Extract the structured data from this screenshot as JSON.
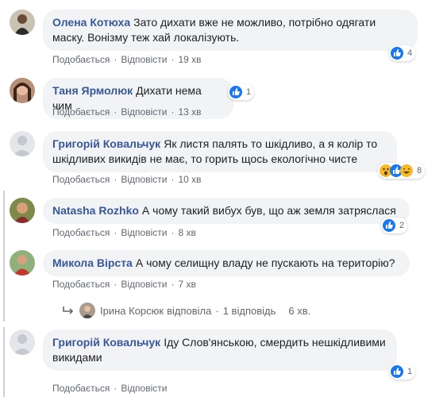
{
  "colors": {
    "bubble": "#f2f3f5",
    "author": "#385898",
    "meta": "#606770",
    "like": "#1877f2",
    "wow": "#f7b928",
    "thread_line": "#ccd0d5"
  },
  "comments": [
    {
      "author": "Олена Котюха",
      "text": "Зато дихати вже не можливо, потрібно одягати маску. Вонізму теж хай локалізують.",
      "like_label": "Подобається",
      "reply_label": "Відповісти",
      "time": "19 хв",
      "reactions": [
        "like-icon"
      ],
      "reaction_count": "4"
    },
    {
      "author": "Таня Ярмолюк",
      "text": "Дихати нема чим",
      "like_label": "Подобається",
      "reply_label": "Відповісти",
      "time": "13 хв",
      "reactions": [
        "like-icon"
      ],
      "reaction_count": "1"
    },
    {
      "author": "Григорій Ковальчук",
      "text": "Як листя палять то шкідливо, а я колір то шкідливих викидів не має, то горить щось екологічно чисте",
      "like_label": "Подобається",
      "reply_label": "Відповісти",
      "time": "10 хв",
      "reactions": [
        "wow-icon",
        "like-icon",
        "haha-icon"
      ],
      "reaction_count": "8"
    },
    {
      "author": "Natasha Rozhko",
      "text": "А чому такий вибух був, що аж земля затряслася",
      "like_label": "Подобається",
      "reply_label": "Відповісти",
      "time": "8 хв",
      "reactions": [
        "like-icon"
      ],
      "reaction_count": "2"
    },
    {
      "author": "Микола Вірста",
      "text": "А чому селищну владу не пускають на територію?",
      "like_label": "Подобається",
      "reply_label": "Відповісти",
      "time": "7 хв",
      "reactions": [],
      "reaction_count": ""
    },
    {
      "author": "Григорій Ковальчук",
      "text": "Іду Слов'янською, смердить нешкідливими викидами",
      "like_label": "Подобається",
      "reply_label": "Відповісти",
      "time": "",
      "reactions": [
        "like-icon"
      ],
      "reaction_count": "1"
    }
  ],
  "reply_summary": {
    "name": "Ірина Корсюк",
    "action": "відповіла",
    "count": "1 відповідь",
    "time": "6 хв."
  }
}
